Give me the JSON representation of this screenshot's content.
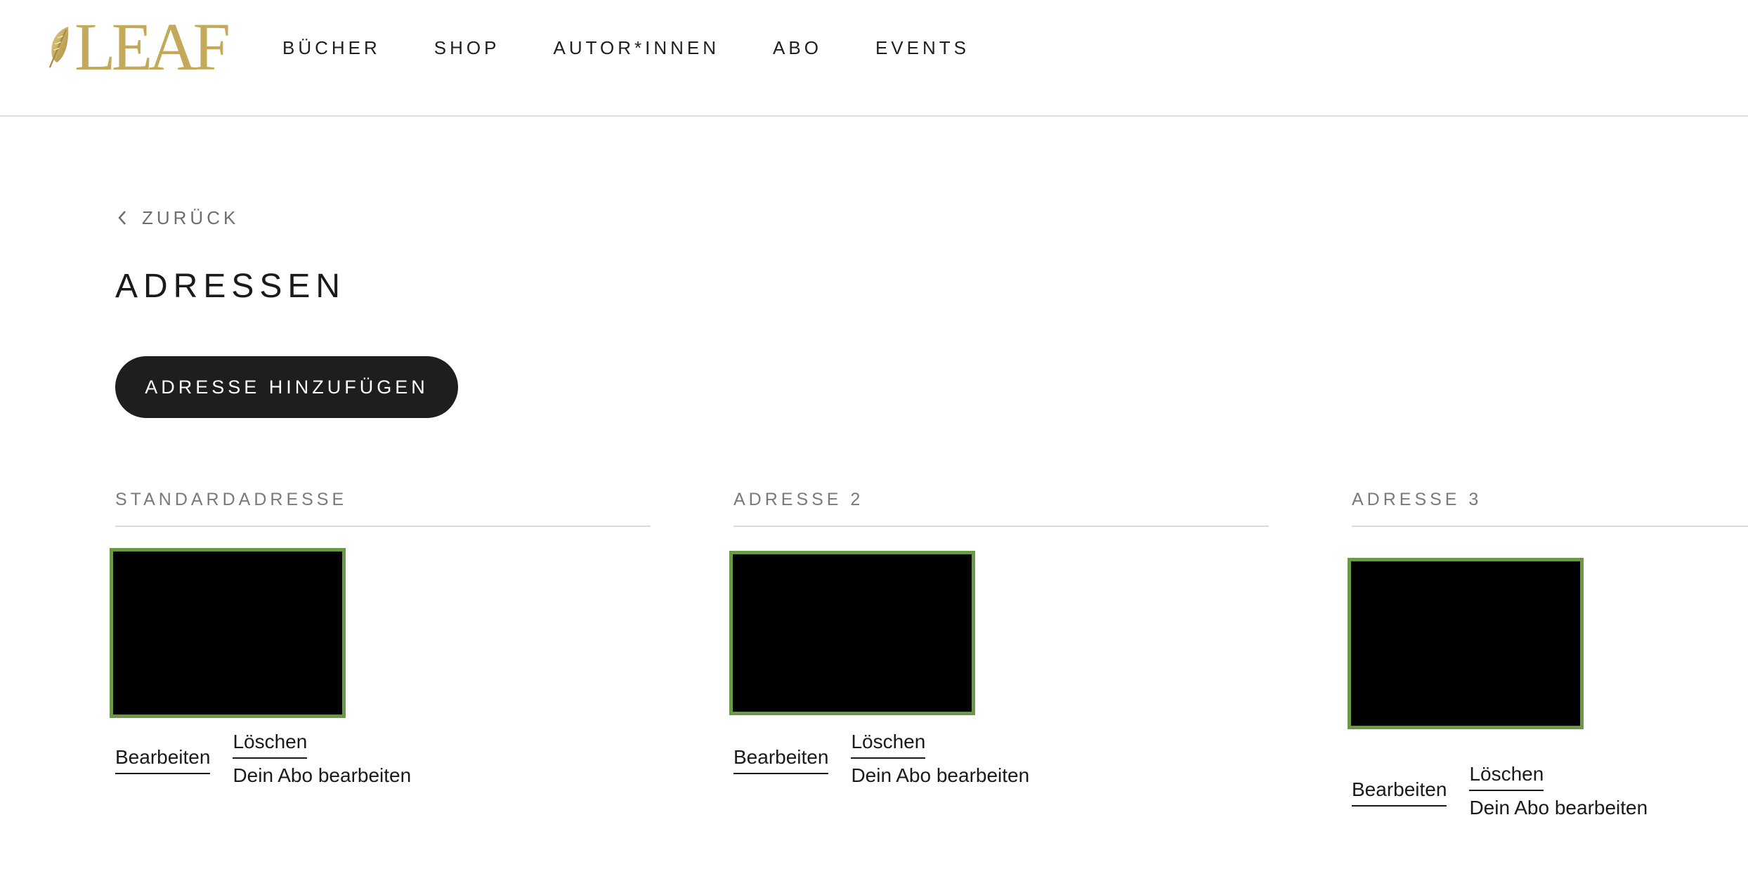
{
  "header": {
    "logo_text": "LEAF",
    "nav": [
      {
        "label": "BÜCHER"
      },
      {
        "label": "SHOP"
      },
      {
        "label": "AUTOR*INNEN"
      },
      {
        "label": "ABO"
      },
      {
        "label": "EVENTS"
      }
    ]
  },
  "main": {
    "back_label": "ZURÜCK",
    "title": "ADRESSEN",
    "add_button_label": "ADRESSE HINZUFÜGEN",
    "cards": [
      {
        "heading": "STANDARDADRESSE",
        "edit_label": "Bearbeiten",
        "delete_label": "Löschen",
        "abo_label": "Dein Abo bearbeiten"
      },
      {
        "heading": "ADRESSE 2",
        "edit_label": "Bearbeiten",
        "delete_label": "Löschen",
        "abo_label": "Dein Abo bearbeiten"
      },
      {
        "heading": "ADRESSE 3",
        "edit_label": "Bearbeiten",
        "delete_label": "Löschen",
        "abo_label": "Dein Abo bearbeiten"
      }
    ]
  },
  "colors": {
    "logo_gold": "#c4a95a",
    "button_bg": "#1e1e1e",
    "redaction_border": "#6a9a45"
  }
}
